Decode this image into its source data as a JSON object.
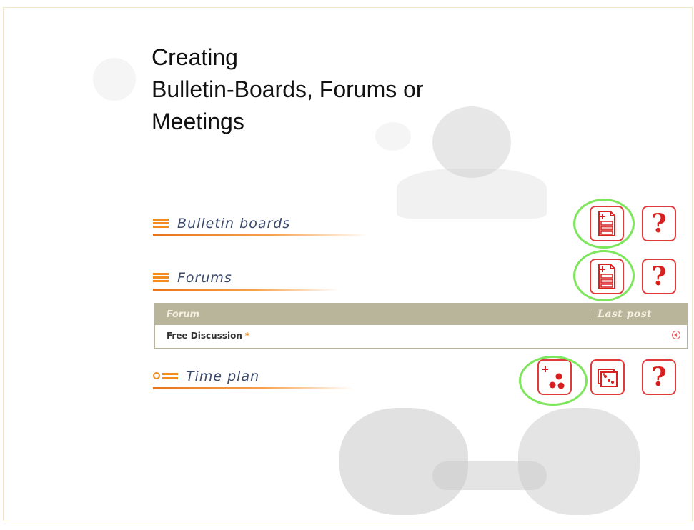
{
  "slide": {
    "title": "Creating\nBulletin-Boards, Forums or\nMeetings"
  },
  "sections": {
    "bulletin": {
      "label": "Bulletin boards",
      "icon": "list-icon"
    },
    "forums": {
      "label": "Forums",
      "icon": "list-icon"
    },
    "timeplan": {
      "label": "Time plan",
      "icon": "time-plan-icon"
    }
  },
  "buttons": {
    "help_glyph": "?",
    "create_icon": "add-document-icon",
    "create_meeting_icon": "add-meeting-icon",
    "meeting_list_icon": "meeting-list-icon"
  },
  "forum_table": {
    "columns": [
      "Forum",
      "Last post"
    ],
    "rows": [
      {
        "name": "Free Discussion",
        "marker": "*",
        "last_post_icon": "arrow-left-circle-icon"
      }
    ]
  },
  "colors": {
    "accent_orange": "#f28c1e",
    "button_red": "#e03a3a",
    "highlight_green": "#7ee65c",
    "table_header": "#b9b59a"
  }
}
